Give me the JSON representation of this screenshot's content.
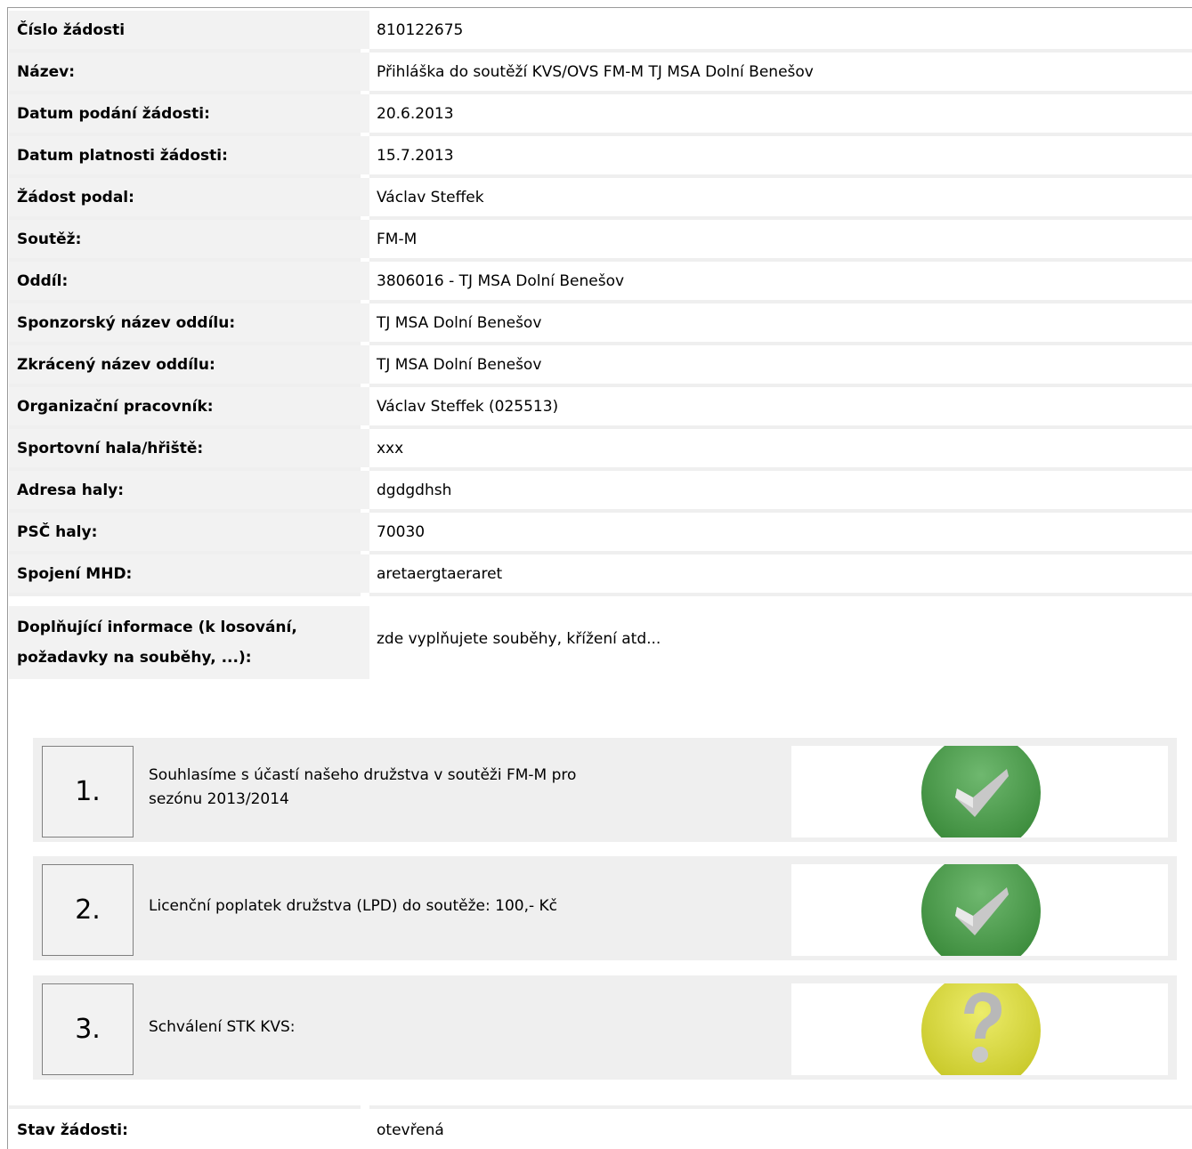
{
  "fields": [
    {
      "label": "Číslo žádosti",
      "value": "810122675"
    },
    {
      "label": "Název:",
      "value": "Přihláška do soutěží KVS/OVS FM-M  TJ MSA Dolní Benešov"
    },
    {
      "label": "Datum podání žádosti:",
      "value": "20.6.2013"
    },
    {
      "label": "Datum platnosti žádosti:",
      "value": "15.7.2013"
    },
    {
      "label": "Žádost podal:",
      "value": "Václav Steffek"
    },
    {
      "label": "Soutěž:",
      "value": "FM-M"
    },
    {
      "label": "Oddíl:",
      "value": "3806016 - TJ MSA Dolní Benešov"
    },
    {
      "label": "Sponzorský název oddílu:",
      "value": "TJ MSA Dolní Benešov"
    },
    {
      "label": "Zkrácený název oddílu:",
      "value": "TJ MSA Dolní Benešov"
    },
    {
      "label": "Organizační pracovník:",
      "value": "Václav Steffek (025513)"
    },
    {
      "label": "Sportovní hala/hřiště:",
      "value": "xxx"
    },
    {
      "label": "Adresa haly:",
      "value": "dgdgdhsh"
    },
    {
      "label": "PSČ haly:",
      "value": "70030"
    },
    {
      "label": "Spojení MHD:",
      "value": "aretaergtaeraret"
    }
  ],
  "additional": {
    "label_line1": "Doplňující informace (k losování,",
    "label_line2": "požadavky na souběhy, ...):",
    "value": "zde vyplňujete souběhy, křížení atd..."
  },
  "steps": [
    {
      "number": "1.",
      "text_line1": "Souhlasíme s účastí našeho družstva v soutěži  FM-M  pro",
      "text_line2": "sezónu 2013/2014",
      "status": "approved",
      "icon": "green-check-icon",
      "color": "#4a9a4a"
    },
    {
      "number": "2.",
      "text_line1": "Licenční poplatek družstva (LPD) do soutěže: 100,- Kč",
      "text_line2": "",
      "status": "approved",
      "icon": "green-check-icon",
      "color": "#4a9a4a"
    },
    {
      "number": "3.",
      "text_line1": "Schválení STK KVS:",
      "text_line2": "",
      "status": "pending",
      "icon": "yellow-question-icon",
      "color": "#d8d83a"
    }
  ],
  "state": {
    "label": "Stav žádosti:",
    "value": "otevřená"
  }
}
